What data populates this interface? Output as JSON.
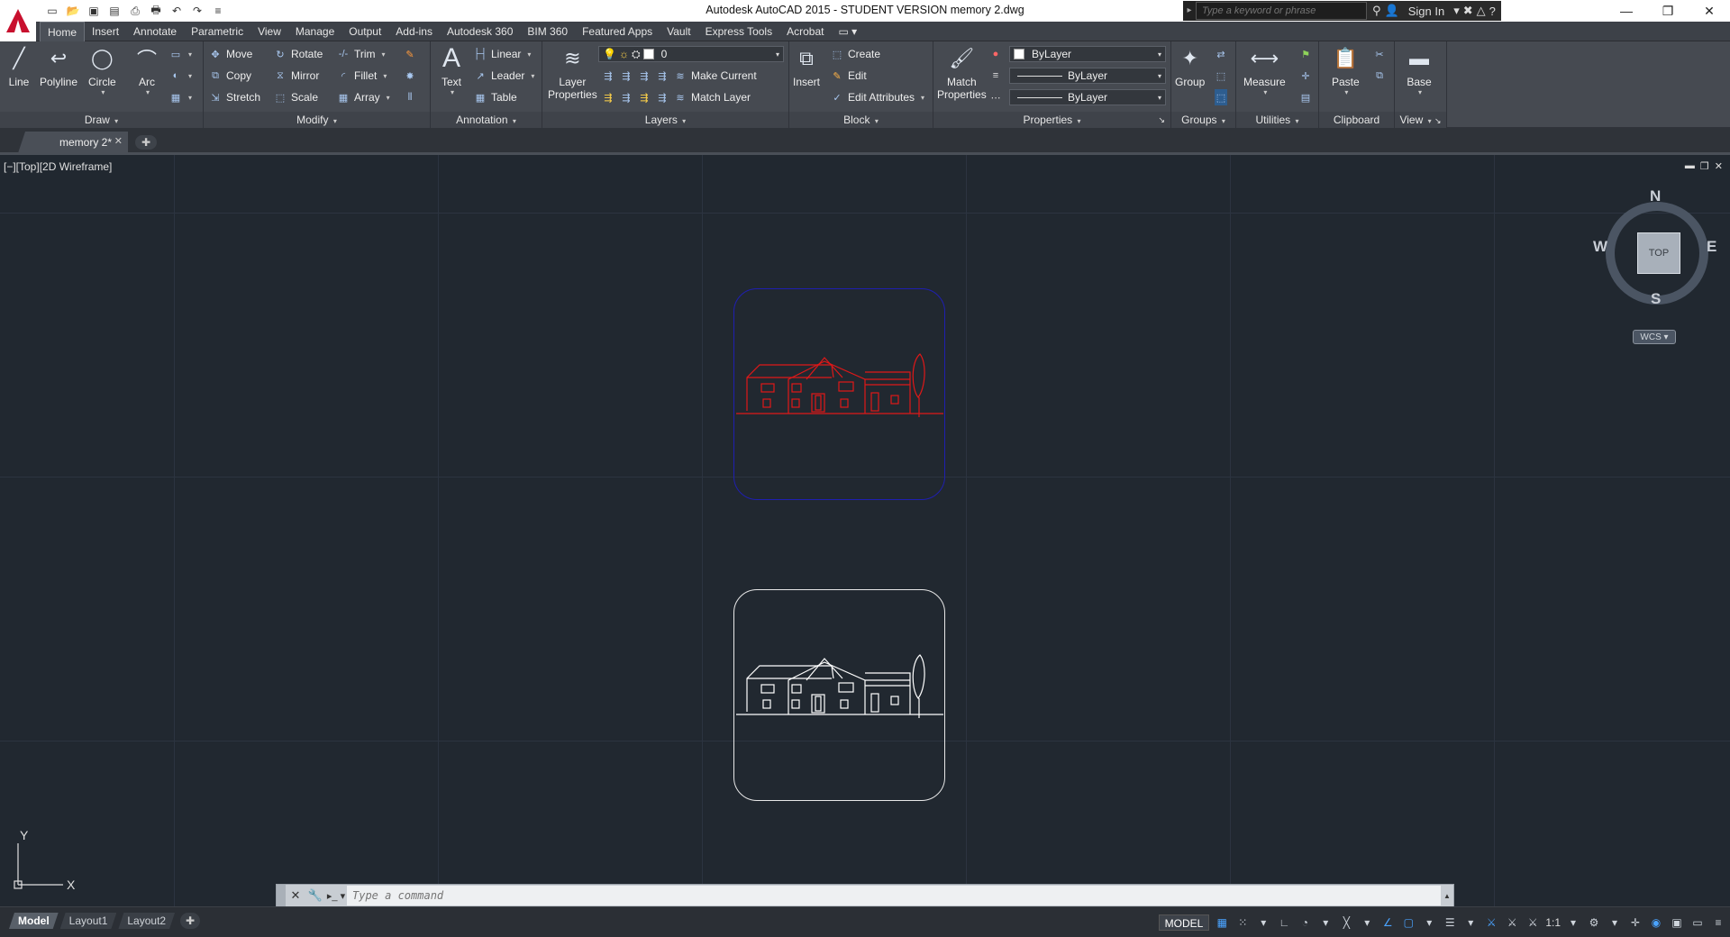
{
  "app": {
    "title": "Autodesk AutoCAD 2015 - STUDENT VERSION    memory 2.dwg"
  },
  "search": {
    "placeholder": "Type a keyword or phrase",
    "sign_in": "Sign In"
  },
  "ribbon_tabs": [
    "Home",
    "Insert",
    "Annotate",
    "Parametric",
    "View",
    "Manage",
    "Output",
    "Add-ins",
    "Autodesk 360",
    "BIM 360",
    "Featured Apps",
    "Vault",
    "Express Tools",
    "Acrobat"
  ],
  "draw": {
    "title": "Draw",
    "line": "Line",
    "polyline": "Polyline",
    "circle": "Circle",
    "arc": "Arc"
  },
  "modify": {
    "title": "Modify",
    "move": "Move",
    "rotate": "Rotate",
    "trim": "Trim",
    "copy": "Copy",
    "mirror": "Mirror",
    "fillet": "Fillet",
    "stretch": "Stretch",
    "scale": "Scale",
    "array": "Array"
  },
  "annotation": {
    "title": "Annotation",
    "text": "Text",
    "linear": "Linear",
    "leader": "Leader",
    "table": "Table"
  },
  "layers": {
    "title": "Layers",
    "layer_properties_1": "Layer",
    "layer_properties_2": "Properties",
    "current_layer": "0",
    "make_current": "Make Current",
    "match_layer": "Match Layer"
  },
  "block": {
    "title": "Block",
    "insert": "Insert",
    "create": "Create",
    "edit": "Edit",
    "edit_attributes": "Edit Attributes"
  },
  "properties": {
    "title": "Properties",
    "match_1": "Match",
    "match_2": "Properties",
    "color": "ByLayer",
    "lineweight": "ByLayer",
    "linetype": "ByLayer"
  },
  "groups": {
    "title": "Groups",
    "group": "Group"
  },
  "utilities": {
    "title": "Utilities",
    "measure": "Measure"
  },
  "clipboard": {
    "title": "Clipboard",
    "paste": "Paste"
  },
  "view_panel": {
    "title": "View",
    "base": "Base"
  },
  "file_tab": {
    "label": "memory 2*"
  },
  "viewport": {
    "label": "[−][Top][2D Wireframe]"
  },
  "viewcube": {
    "n": "N",
    "s": "S",
    "e": "E",
    "w": "W",
    "top": "TOP",
    "wcs": "WCS"
  },
  "ucs": {
    "x": "X",
    "y": "Y"
  },
  "drawing": {
    "colors": {
      "top_card_border": "#1f1fb0",
      "top_house": "#e01818",
      "bottom_card_border": "#e8e8e8",
      "bottom_house": "#ffffff"
    }
  },
  "command": {
    "placeholder": "Type a command"
  },
  "layout_tabs": [
    "Model",
    "Layout1",
    "Layout2"
  ],
  "status": {
    "model": "MODEL",
    "scale": "1:1"
  }
}
